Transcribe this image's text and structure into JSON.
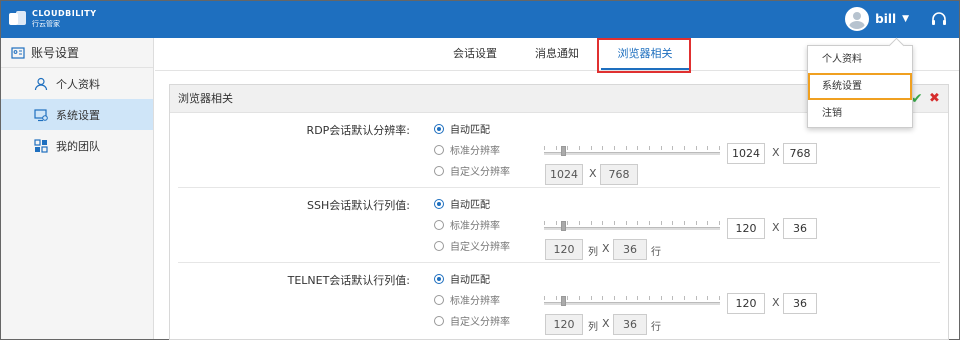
{
  "header": {
    "logo_en": "CLOUDBILITY",
    "logo_cn": "行云管家",
    "username": "bill",
    "caret": "▼"
  },
  "sidebar": {
    "title": "账号设置",
    "items": [
      {
        "label": "个人资料",
        "icon": "user-icon"
      },
      {
        "label": "系统设置",
        "icon": "monitor-settings-icon",
        "active": true
      },
      {
        "label": "我的团队",
        "icon": "team-icon"
      }
    ]
  },
  "tabs": [
    {
      "label": "会话设置"
    },
    {
      "label": "消息通知"
    },
    {
      "label": "浏览器相关",
      "active": true
    }
  ],
  "panel": {
    "title": "浏览器相关",
    "sections": [
      {
        "label": "RDP会话默认分辨率:",
        "options": [
          "自动匹配",
          "标准分辨率",
          "自定义分辨率"
        ],
        "selected": 0,
        "slider_level": 0.1,
        "standard": {
          "w": "1024",
          "h": "768"
        },
        "custom": {
          "w": "1024",
          "h": "768"
        },
        "unit_w": "",
        "unit_h": ""
      },
      {
        "label": "SSH会话默认行列值:",
        "options": [
          "自动匹配",
          "标准分辨率",
          "自定义分辨率"
        ],
        "selected": 0,
        "slider_level": 0.1,
        "standard": {
          "w": "120",
          "h": "36"
        },
        "custom": {
          "w": "120",
          "h": "36"
        },
        "unit_w": "列",
        "unit_h": "行"
      },
      {
        "label": "TELNET会话默认行列值:",
        "options": [
          "自动匹配",
          "标准分辨率",
          "自定义分辨率"
        ],
        "selected": 0,
        "slider_level": 0.1,
        "standard": {
          "w": "120",
          "h": "36"
        },
        "custom": {
          "w": "120",
          "h": "36"
        },
        "unit_w": "列",
        "unit_h": "行"
      }
    ],
    "x_sep": "X"
  },
  "dropdown": {
    "items": [
      "个人资料",
      "系统设置",
      "注销"
    ],
    "highlighted": 1
  },
  "actions": {
    "confirm": "✔",
    "cancel": "✖"
  },
  "colors": {
    "brand": "#1e6fbf",
    "active_nav": "#cfe5f8",
    "highlight_red": "#e03030",
    "highlight_orange": "#f0a020",
    "ok_green": "#3aa84a",
    "cancel_red": "#d62c2c"
  }
}
